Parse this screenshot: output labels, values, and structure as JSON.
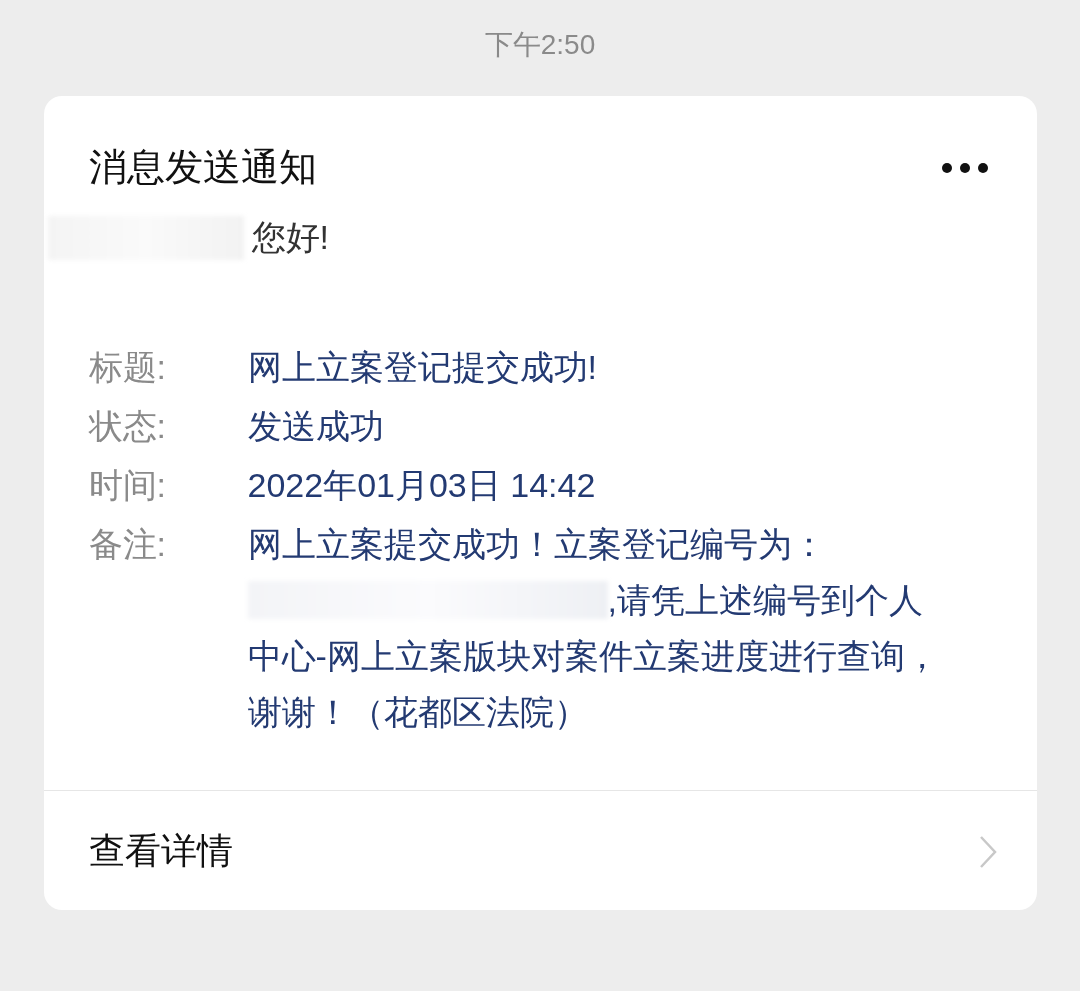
{
  "time": "下午2:50",
  "card": {
    "title": "消息发送通知",
    "greeting": "您好!",
    "fields": [
      {
        "label": "标题:",
        "value": "网上立案登记提交成功!"
      },
      {
        "label": "状态:",
        "value": "发送成功"
      },
      {
        "label": "时间:",
        "value": "2022年01月03日 14:42"
      }
    ],
    "remark": {
      "label": "备注:",
      "before": "网上立案提交成功！立案登记编号为：",
      "after": [
        ",请凭上述编号到个人",
        "中心-网上立案版块对案件立案进度进行查询，谢谢！（花都区法院）"
      ]
    },
    "footer_link": "查看详情"
  }
}
